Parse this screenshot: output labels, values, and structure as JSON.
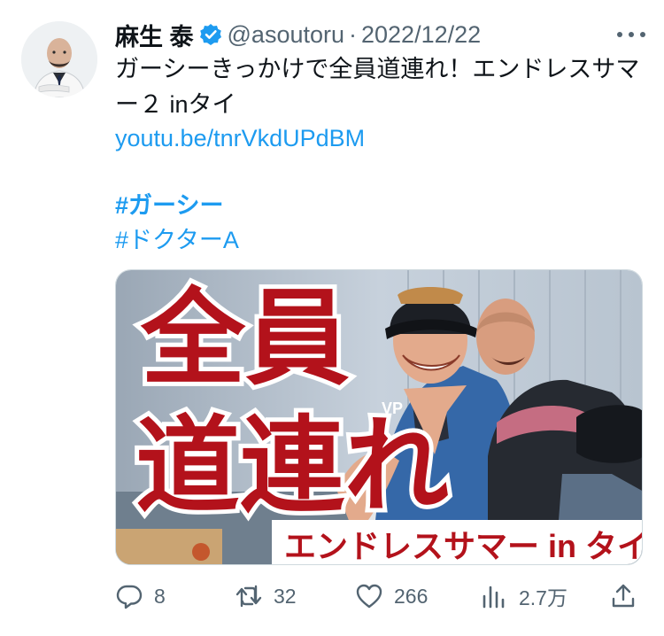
{
  "author": {
    "display_name": "麻生 泰",
    "handle": "@asoutoru",
    "date": "2022/12/22",
    "separator": "·"
  },
  "tweet": {
    "text": "ガーシーきっかけで全員道連れ！エンドレスサマー２ inタイ",
    "link": "youtu.be/tnrVkdUPdBM",
    "hashtags": [
      "#ガーシー",
      "#ドクターA"
    ]
  },
  "media": {
    "headline_line1": "全員",
    "headline_line2": "道連れ",
    "banner": "エンドレスサマー in タイ",
    "vest_badge": "VP"
  },
  "actions": {
    "reply_count": "8",
    "retweet_count": "32",
    "like_count": "266",
    "views_count": "2.7万"
  },
  "colors": {
    "link": "#1d9bf0",
    "secondary_text": "#536471",
    "headline_red": "#b3121b",
    "banner_bg": "#ffffff"
  },
  "icons": [
    "verified-badge-icon",
    "more-icon",
    "reply-icon",
    "retweet-icon",
    "like-icon",
    "views-icon",
    "share-icon"
  ]
}
